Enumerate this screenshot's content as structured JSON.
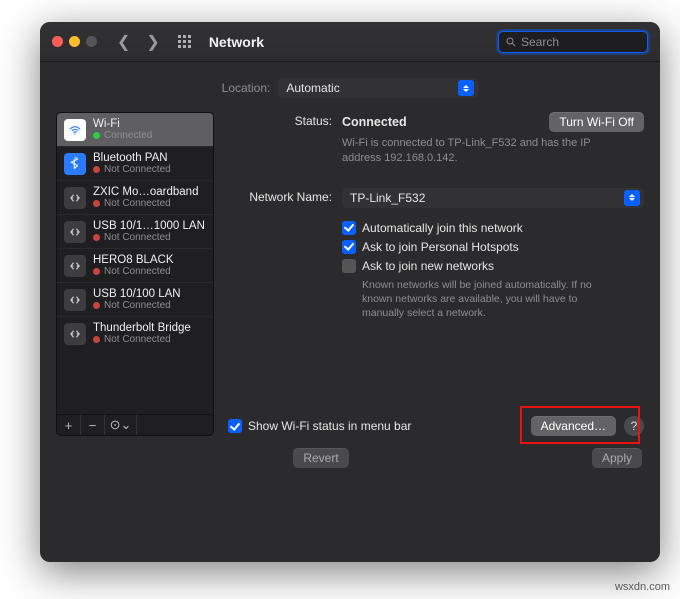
{
  "window": {
    "title": "Network"
  },
  "search": {
    "placeholder": "Search"
  },
  "location": {
    "label": "Location:",
    "value": "Automatic"
  },
  "services": [
    {
      "name": "Wi-Fi",
      "status": "Connected",
      "dot": "green",
      "icon": "wifi",
      "selected": true
    },
    {
      "name": "Bluetooth PAN",
      "status": "Not Connected",
      "dot": "red",
      "icon": "bt",
      "selected": false
    },
    {
      "name": "ZXIC Mo…oardband",
      "status": "Not Connected",
      "dot": "red",
      "icon": "eth",
      "selected": false
    },
    {
      "name": "USB 10/1…1000 LAN",
      "status": "Not Connected",
      "dot": "red",
      "icon": "eth",
      "selected": false
    },
    {
      "name": "HERO8 BLACK",
      "status": "Not Connected",
      "dot": "red",
      "icon": "eth",
      "selected": false
    },
    {
      "name": "USB 10/100 LAN",
      "status": "Not Connected",
      "dot": "red",
      "icon": "eth",
      "selected": false
    },
    {
      "name": "Thunderbolt Bridge",
      "status": "Not Connected",
      "dot": "red",
      "icon": "eth",
      "selected": false
    }
  ],
  "sidebar_buttons": {
    "add": "+",
    "remove": "−",
    "action": "⊙⌄"
  },
  "detail": {
    "status_label": "Status:",
    "status_value": "Connected",
    "turn_off": "Turn Wi-Fi Off",
    "status_sub": "Wi-Fi is connected to TP-Link_F532 and has the IP address 192.168.0.142.",
    "network_name_label": "Network Name:",
    "network_name_value": "TP-Link_F532",
    "auto_join": "Automatically join this network",
    "ask_hotspot": "Ask to join Personal Hotspots",
    "ask_new": "Ask to join new networks",
    "ask_new_hint": "Known networks will be joined automatically. If no known networks are available, you will have to manually select a network.",
    "show_menu": "Show Wi-Fi status in menu bar",
    "advanced": "Advanced…",
    "help": "?"
  },
  "footer": {
    "revert": "Revert",
    "apply": "Apply"
  },
  "watermark": "wsxdn.com"
}
